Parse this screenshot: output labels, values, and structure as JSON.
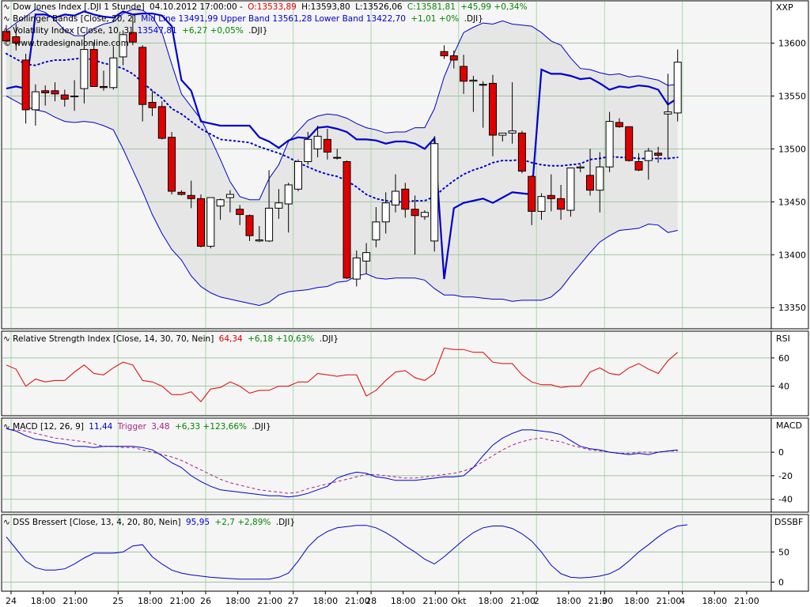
{
  "colors": {
    "panel_bg": "#f5f5f5",
    "band_fill": "#e6e6e6",
    "grid_v": "#a8d8a8",
    "grid_h": "#a0c4a0",
    "bull_fill": "#ffffff",
    "bear_fill": "#e00000",
    "candle_outline": "#000000",
    "blue": "#0000cc",
    "rsi": "#e00000",
    "trigger": "#aa2288",
    "green": "#008800",
    "red": "#e00000",
    "text": "#000000"
  },
  "legend": {
    "price": {
      "label": "Dow Jones Index [.DJI  1 Stunde]",
      "date": "04.10.2012 17:00:00 -",
      "open": "O:13533,89",
      "high": "H:13593,80",
      "low": "L:13526,06",
      "close": "C:13581,81",
      "change": "+45,99 +0,34%"
    },
    "bollinger": {
      "label": "Bollinger Bands [Close, 20, 2]",
      "values": "Mid Line 13491,99 Upper Band 13561,28 Lower Band 13422,70",
      "change": "+1,01 +0%",
      "symbol": ".DJI}"
    },
    "volatility": {
      "label": "Volatility Index [Close, 10, 3]",
      "value": "13547,81",
      "change": "+6,27 +0,05%",
      "symbol": ".DJI}"
    },
    "copyright": "© www.tradesignalonline.com",
    "rsi": {
      "label": "Relative Strength Index [Close, 14, 30, 70, Nein]",
      "value": "64,34",
      "change": "+6,18 +10,63%",
      "symbol": ".DJI}"
    },
    "macd": {
      "label": "MACD [12, 26, 9]",
      "value": "11,44",
      "trigger_label": "Trigger",
      "trigger_value": "3,48",
      "change": "+6,33 +123,66%",
      "symbol": ".DJI}"
    },
    "dss": {
      "label": "DSS Bressert [Close, 13, 4, 20, 80, Nein]",
      "value": "95,95",
      "change": "+2,7 +2,89%",
      "symbol": ".DJI}"
    }
  },
  "chart_data": [
    {
      "type": "candlestick",
      "title": "Dow Jones Index [.DJI 1 Stunde]",
      "axis_title": "XXP",
      "y_ticks": [
        13350,
        13400,
        13450,
        13500,
        13550,
        13600
      ],
      "ylim": [
        13330,
        13640
      ],
      "candles": [
        {
          "o": 13611,
          "h": 13617,
          "l": 13603,
          "c": 13602
        },
        {
          "o": 13606,
          "h": 13618,
          "l": 13593,
          "c": 13600
        },
        {
          "o": 13584,
          "h": 13590,
          "l": 13524,
          "c": 13537
        },
        {
          "o": 13537,
          "h": 13561,
          "l": 13522,
          "c": 13554
        },
        {
          "o": 13555,
          "h": 13560,
          "l": 13541,
          "c": 13553
        },
        {
          "o": 13555,
          "h": 13563,
          "l": 13545,
          "c": 13552
        },
        {
          "o": 13551,
          "h": 13556,
          "l": 13540,
          "c": 13547
        },
        {
          "o": 13550,
          "h": 13565,
          "l": 13536,
          "c": 13550
        },
        {
          "o": 13557,
          "h": 13608,
          "l": 13543,
          "c": 13594
        },
        {
          "o": 13594,
          "h": 13601,
          "l": 13559,
          "c": 13559
        },
        {
          "o": 13559,
          "h": 13574,
          "l": 13555,
          "c": 13558
        },
        {
          "o": 13558,
          "h": 13597,
          "l": 13556,
          "c": 13586
        },
        {
          "o": 13587,
          "h": 13612,
          "l": 13579,
          "c": 13608
        },
        {
          "o": 13610,
          "h": 13626,
          "l": 13598,
          "c": 13601
        },
        {
          "o": 13596,
          "h": 13598,
          "l": 13526,
          "c": 13542
        },
        {
          "o": 13544,
          "h": 13555,
          "l": 13531,
          "c": 13539
        },
        {
          "o": 13540,
          "h": 13545,
          "l": 13509,
          "c": 13510
        },
        {
          "o": 13511,
          "h": 13516,
          "l": 13457,
          "c": 13460
        },
        {
          "o": 13459,
          "h": 13461,
          "l": 13456,
          "c": 13457
        },
        {
          "o": 13456,
          "h": 13470,
          "l": 13444,
          "c": 13453
        },
        {
          "o": 13453,
          "h": 13457,
          "l": 13407,
          "c": 13408
        },
        {
          "o": 13408,
          "h": 13444,
          "l": 13406,
          "c": 13454
        },
        {
          "o": 13446,
          "h": 13453,
          "l": 13433,
          "c": 13452
        },
        {
          "o": 13454,
          "h": 13461,
          "l": 13440,
          "c": 13457
        },
        {
          "o": 13443,
          "h": 13447,
          "l": 13428,
          "c": 13438
        },
        {
          "o": 13437,
          "h": 13438,
          "l": 13413,
          "c": 13418
        },
        {
          "o": 13413,
          "h": 13427,
          "l": 13412,
          "c": 13414
        },
        {
          "o": 13413,
          "h": 13480,
          "l": 13412,
          "c": 13444
        },
        {
          "o": 13444,
          "h": 13462,
          "l": 13434,
          "c": 13449
        },
        {
          "o": 13448,
          "h": 13468,
          "l": 13421,
          "c": 13466
        },
        {
          "o": 13462,
          "h": 13490,
          "l": 13460,
          "c": 13488
        },
        {
          "o": 13488,
          "h": 13516,
          "l": 13485,
          "c": 13509
        },
        {
          "o": 13500,
          "h": 13522,
          "l": 13492,
          "c": 13512
        },
        {
          "o": 13509,
          "h": 13519,
          "l": 13490,
          "c": 13497
        },
        {
          "o": 13492,
          "h": 13500,
          "l": 13490,
          "c": 13492
        },
        {
          "o": 13488,
          "h": 13489,
          "l": 13377,
          "c": 13378
        },
        {
          "o": 13377,
          "h": 13404,
          "l": 13370,
          "c": 13397
        },
        {
          "o": 13394,
          "h": 13411,
          "l": 13382,
          "c": 13402
        },
        {
          "o": 13414,
          "h": 13445,
          "l": 13407,
          "c": 13431
        },
        {
          "o": 13431,
          "h": 13459,
          "l": 13420,
          "c": 13449
        },
        {
          "o": 13447,
          "h": 13476,
          "l": 13440,
          "c": 13460
        },
        {
          "o": 13462,
          "h": 13468,
          "l": 13435,
          "c": 13443
        },
        {
          "o": 13443,
          "h": 13456,
          "l": 13400,
          "c": 13437
        },
        {
          "o": 13436,
          "h": 13442,
          "l": 13433,
          "c": 13440
        },
        {
          "o": 13413,
          "h": 13512,
          "l": 13403,
          "c": 13505
        },
        {
          "o": 13592,
          "h": 13598,
          "l": 13585,
          "c": 13588
        },
        {
          "o": 13588,
          "h": 13593,
          "l": 13576,
          "c": 13584
        },
        {
          "o": 13578,
          "h": 13589,
          "l": 13552,
          "c": 13564
        },
        {
          "o": 13564,
          "h": 13569,
          "l": 13535,
          "c": 13565
        },
        {
          "o": 13561,
          "h": 13564,
          "l": 13520,
          "c": 13561
        },
        {
          "o": 13562,
          "h": 13570,
          "l": 13493,
          "c": 13513
        },
        {
          "o": 13513,
          "h": 13515,
          "l": 13507,
          "c": 13515
        },
        {
          "o": 13515,
          "h": 13563,
          "l": 13505,
          "c": 13517
        },
        {
          "o": 13515,
          "h": 13517,
          "l": 13477,
          "c": 13479
        },
        {
          "o": 13474,
          "h": 13475,
          "l": 13428,
          "c": 13441
        },
        {
          "o": 13441,
          "h": 13458,
          "l": 13433,
          "c": 13455
        },
        {
          "o": 13456,
          "h": 13476,
          "l": 13441,
          "c": 13453
        },
        {
          "o": 13453,
          "h": 13466,
          "l": 13433,
          "c": 13443
        },
        {
          "o": 13442,
          "h": 13482,
          "l": 13436,
          "c": 13482
        },
        {
          "o": 13482,
          "h": 13485,
          "l": 13478,
          "c": 13483
        },
        {
          "o": 13475,
          "h": 13500,
          "l": 13456,
          "c": 13461
        },
        {
          "o": 13461,
          "h": 13497,
          "l": 13440,
          "c": 13483
        },
        {
          "o": 13483,
          "h": 13535,
          "l": 13478,
          "c": 13526
        },
        {
          "o": 13525,
          "h": 13529,
          "l": 13520,
          "c": 13521
        },
        {
          "o": 13521,
          "h": 13521,
          "l": 13488,
          "c": 13489
        },
        {
          "o": 13488,
          "h": 13496,
          "l": 13479,
          "c": 13480
        },
        {
          "o": 13489,
          "h": 13501,
          "l": 13471,
          "c": 13498
        },
        {
          "o": 13496,
          "h": 13502,
          "l": 13487,
          "c": 13494
        },
        {
          "o": 13533,
          "h": 13571,
          "l": 13490,
          "c": 13535
        },
        {
          "o": 13534,
          "h": 13594,
          "l": 13526,
          "c": 13582
        }
      ],
      "bollinger_upper": [
        13612,
        13619,
        13625,
        13632,
        13629,
        13622,
        13612,
        13607,
        13607,
        13614,
        13618,
        13620,
        13628,
        13632,
        13631,
        13625,
        13610,
        13580,
        13552,
        13540,
        13528,
        13510,
        13490,
        13469,
        13455,
        13452,
        13452,
        13472,
        13485,
        13507,
        13517,
        13527,
        13531,
        13533,
        13532,
        13529,
        13524,
        13520,
        13518,
        13515,
        13516,
        13516,
        13520,
        13520,
        13538,
        13568,
        13590,
        13610,
        13615,
        13619,
        13618,
        13621,
        13618,
        13617,
        13616,
        13610,
        13602,
        13598,
        13586,
        13576,
        13575,
        13572,
        13570,
        13571,
        13568,
        13569,
        13567,
        13565,
        13560,
        13561
      ],
      "bollinger_lower": [
        13550,
        13545,
        13540,
        13537,
        13535,
        13530,
        13526,
        13525,
        13526,
        13525,
        13522,
        13518,
        13500,
        13480,
        13460,
        13438,
        13420,
        13405,
        13395,
        13380,
        13370,
        13364,
        13360,
        13358,
        13356,
        13354,
        13352,
        13355,
        13362,
        13365,
        13366,
        13367,
        13369,
        13370,
        13374,
        13375,
        13380,
        13382,
        13378,
        13377,
        13378,
        13378,
        13378,
        13376,
        13368,
        13362,
        13362,
        13360,
        13360,
        13359,
        13358,
        13358,
        13356,
        13357,
        13357,
        13357,
        13360,
        13368,
        13380,
        13391,
        13402,
        13412,
        13418,
        13423,
        13424,
        13425,
        13429,
        13428,
        13421,
        13423
      ],
      "mid_line": [
        13590,
        13585,
        13580,
        13579,
        13582,
        13584,
        13584,
        13585,
        13586,
        13584,
        13581,
        13579,
        13576,
        13571,
        13563,
        13555,
        13548,
        13538,
        13533,
        13526,
        13519,
        13514,
        13509,
        13508,
        13507,
        13506,
        13502,
        13499,
        13496,
        13492,
        13487,
        13483,
        13479,
        13476,
        13474,
        13470,
        13464,
        13457,
        13453,
        13451,
        13450,
        13450,
        13451,
        13451,
        13455,
        13463,
        13470,
        13476,
        13480,
        13483,
        13487,
        13489,
        13489,
        13490,
        13487,
        13485,
        13484,
        13484,
        13485,
        13486,
        13490,
        13491,
        13493,
        13492,
        13492,
        13491,
        13491,
        13491,
        13491,
        13492
      ],
      "volatility_index": [
        13557,
        13559,
        13557,
        13627,
        13627,
        13624,
        13627,
        13626,
        13630,
        13627,
        13625,
        13624,
        13630,
        13627,
        13628,
        13628,
        13626,
        13616,
        13565,
        13555,
        13526,
        13524,
        13522,
        13522,
        13522,
        13522,
        13511,
        13507,
        13501,
        13508,
        13511,
        13510,
        13520,
        13521,
        13519,
        13516,
        13509,
        13509,
        13508,
        13505,
        13507,
        13507,
        13505,
        13500,
        13510,
        13377,
        13444,
        13449,
        13451,
        13453,
        13449,
        13454,
        13459,
        13458,
        13457,
        13575,
        13571,
        13571,
        13569,
        13566,
        13567,
        13562,
        13556,
        13559,
        13558,
        13560,
        13559,
        13556,
        13542,
        13548
      ]
    },
    {
      "type": "line",
      "title": "Relative Strength Index [Close, 14, 30, 70, Nein]",
      "axis_title": "RSI",
      "y_ticks": [
        40,
        60
      ],
      "ylim": [
        19,
        79
      ],
      "values": [
        55,
        52,
        40,
        45,
        43,
        44,
        44,
        50,
        55,
        49,
        48,
        53,
        57,
        55,
        44,
        43,
        40,
        34,
        34,
        36,
        29,
        38,
        39,
        43,
        40,
        35,
        37,
        37,
        40,
        40,
        43,
        43,
        49,
        48,
        47,
        48,
        48,
        33,
        37,
        44,
        50,
        51,
        46,
        44,
        49,
        67,
        66,
        66,
        64,
        64,
        57,
        56,
        56,
        48,
        43,
        41,
        41,
        39,
        40,
        40,
        50,
        53,
        49,
        48,
        53,
        56,
        52,
        49,
        58,
        64
      ]
    },
    {
      "type": "line",
      "title": "MACD [12, 26, 9]",
      "axis_title": "MACD",
      "y_ticks": [
        -40,
        -20,
        0
      ],
      "ylim": [
        -51,
        29
      ],
      "series": [
        {
          "name": "MACD",
          "values": [
            20,
            18,
            14,
            11,
            10,
            8,
            7,
            5,
            5,
            4,
            5,
            5,
            5,
            5,
            4,
            2,
            -3,
            -9,
            -13,
            -20,
            -25,
            -29,
            -32,
            -33,
            -34,
            -35,
            -36,
            -37,
            -37,
            -38,
            -37,
            -35,
            -32,
            -29,
            -22,
            -19,
            -17,
            -18,
            -21,
            -22,
            -24,
            -24,
            -24,
            -23,
            -22,
            -21,
            -21,
            -20,
            -13,
            -3,
            6,
            12,
            16,
            19,
            19,
            18,
            17,
            15,
            10,
            5,
            3,
            2,
            0,
            -1,
            -2,
            -1,
            -2,
            0,
            1,
            2
          ]
        },
        {
          "name": "Trigger",
          "values": [
            20,
            19,
            18,
            16,
            14,
            12,
            11,
            10,
            9,
            7,
            5,
            5,
            4,
            4,
            2,
            0,
            -2,
            -4,
            -7,
            -11,
            -15,
            -19,
            -23,
            -26,
            -28,
            -30,
            -32,
            -33,
            -34,
            -35,
            -34,
            -31,
            -29,
            -27,
            -25,
            -23,
            -21,
            -19,
            -19,
            -20,
            -21,
            -22,
            -22,
            -21,
            -20,
            -19,
            -18,
            -16,
            -13,
            -8,
            -3,
            2,
            6,
            9,
            11,
            12,
            10,
            9,
            6,
            4,
            2,
            1,
            0,
            -1,
            -1,
            0,
            0,
            0,
            1,
            1
          ]
        }
      ]
    },
    {
      "type": "line",
      "title": "DSS Bressert [Close, 13, 4, 20, 80, Nein]",
      "axis_title": "DSSBF",
      "y_ticks": [
        0,
        50
      ],
      "ylim": [
        -15,
        112
      ],
      "values": [
        75,
        55,
        35,
        24,
        20,
        20,
        22,
        30,
        40,
        48,
        48,
        48,
        50,
        60,
        62,
        42,
        30,
        20,
        15,
        12,
        10,
        8,
        7,
        6,
        5,
        5,
        5,
        5,
        8,
        15,
        35,
        58,
        74,
        84,
        90,
        92,
        94,
        94,
        90,
        82,
        72,
        60,
        50,
        38,
        30,
        42,
        56,
        70,
        82,
        90,
        93,
        93,
        89,
        80,
        68,
        50,
        28,
        14,
        8,
        7,
        8,
        10,
        14,
        22,
        35,
        50,
        62,
        75,
        86,
        93,
        95
      ]
    }
  ],
  "time_axis": {
    "labels": [
      "24",
      "18:00",
      "21:00",
      "25",
      "18:00",
      "21:00",
      "26",
      "18:00",
      "21:00",
      "27",
      "18:00",
      "21:00",
      "28",
      "18:00",
      "21:00",
      "Okt",
      "18:00",
      "21:00",
      "2",
      "18:00",
      "21:00",
      "3",
      "18:00",
      "21:00",
      "4",
      "18:00",
      "21:00"
    ],
    "day_starts": [
      0,
      11,
      20,
      29,
      37,
      46,
      54,
      61,
      69
    ]
  }
}
